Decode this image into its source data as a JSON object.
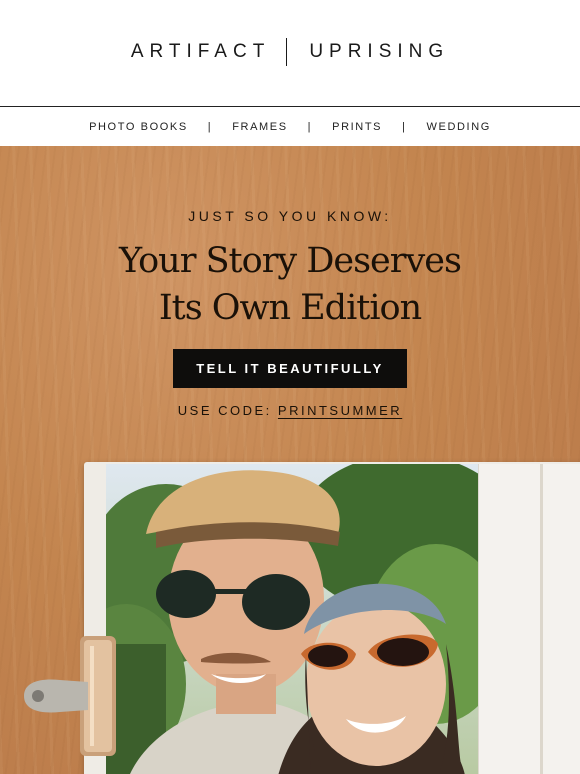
{
  "brand": {
    "left": "ARTIFACT",
    "right": "UPRISING"
  },
  "nav": {
    "items": [
      "PHOTO BOOKS",
      "FRAMES",
      "PRINTS",
      "WEDDING"
    ],
    "separator": "|"
  },
  "hero": {
    "eyebrow": "JUST SO YOU KNOW:",
    "headline_line1": "Your Story Deserves",
    "headline_line2": "Its Own Edition",
    "cta_label": "TELL IT BEAUTIFULLY",
    "code_prefix": "USE CODE:",
    "code_value": "PRINTSUMMER"
  },
  "colors": {
    "wood": "#c3854f",
    "button": "#0e0d0c",
    "text": "#1a1108"
  }
}
